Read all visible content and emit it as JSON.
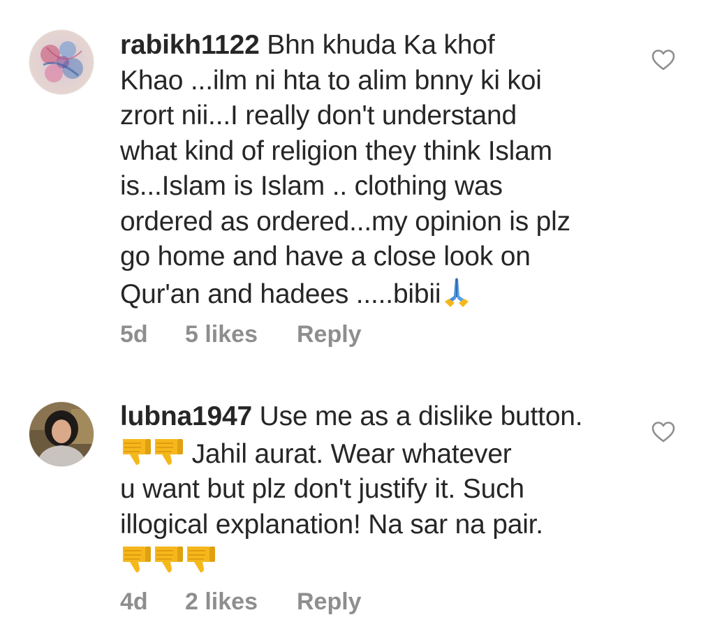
{
  "comments": [
    {
      "username": "rabikh1122",
      "lines": [
        " Bhn khuda Ka khof",
        "Khao ...ilm ni hta to alim bnny ki koi",
        "zrort nii...I really don't understand",
        "what kind of religion they think Islam",
        "is...Islam is Islam .. clothing was",
        "ordered as ordered...my opinion is plz",
        "go home and have a close look on",
        "Qur'an and hadees .....bibii"
      ],
      "trailing_emoji": "folded-hands-emoji",
      "time": "5d",
      "likes": "5 likes",
      "reply": "Reply"
    },
    {
      "username": "lubna1947",
      "first_line": " Use me as a dislike button.",
      "second_line": " Jahil aurat. Wear whatever",
      "lines": [
        "u want but plz don't justify it. Such",
        "illogical explanation! Na sar na pair."
      ],
      "emoji": "thumbs-down-emoji",
      "time": "4d",
      "likes": "2 likes",
      "reply": "Reply"
    }
  ],
  "colors": {
    "text": "#262626",
    "meta": "#8e8e8e",
    "heart": "#8e8e8e",
    "emoji_yellow": "#f5b81c",
    "emoji_blue": "#4a90d9"
  }
}
